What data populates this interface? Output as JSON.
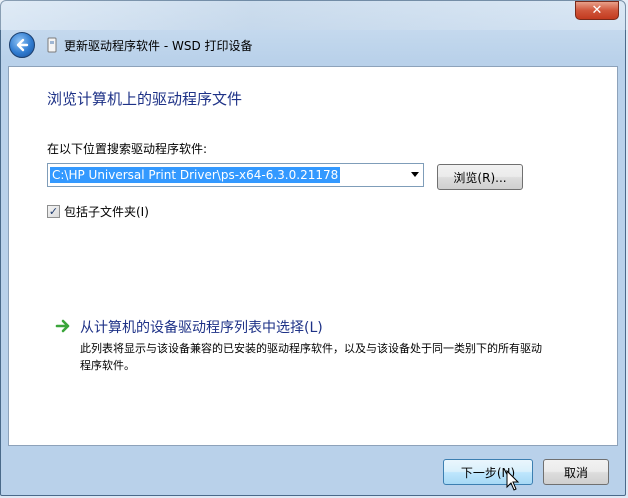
{
  "window": {
    "title": "更新驱动程序软件 - WSD 打印设备",
    "close_glyph": "✕"
  },
  "main": {
    "heading": "浏览计算机上的驱动程序文件",
    "search_label": "在以下位置搜索驱动程序软件:",
    "path_value": "C:\\HP Universal Print Driver\\ps-x64-6.3.0.21178",
    "browse_label": "浏览(R)...",
    "include_subfolders": {
      "label": "包括子文件夹(I)",
      "checked": true
    },
    "pick_option": {
      "title": "从计算机的设备驱动程序列表中选择(L)",
      "description": "此列表将显示与该设备兼容的已安装的驱动程序软件，以及与该设备处于同一类别下的所有驱动程序软件。"
    }
  },
  "footer": {
    "next_label": "下一步(N)",
    "cancel_label": "取消"
  },
  "icons": {
    "back": "back-arrow-icon",
    "title": "printer-icon",
    "pick": "green-arrow-icon"
  },
  "colors": {
    "heading": "#1e3287",
    "selection": "#3399ff",
    "link_arrow": "#3aa53a"
  }
}
